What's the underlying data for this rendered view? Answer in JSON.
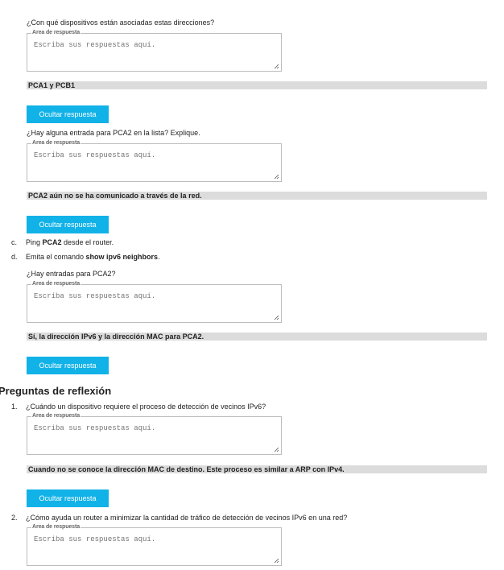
{
  "common": {
    "legend": "Area de respuesta",
    "placeholder": "Escriba sus respuestas aquí.",
    "hide_label": "Ocultar respuesta"
  },
  "q1": {
    "text": "¿Con qué dispositivos están asociadas estas direcciones?",
    "answer": "PCA1 y PCB1"
  },
  "q2": {
    "text": "¿Hay alguna entrada para PCA2 en la lista? Explique.",
    "answer": "PCA2 aún no se ha comunicado a través de la red."
  },
  "step_c": {
    "marker": "c.",
    "pre": "Ping ",
    "bold": "PCA2",
    "post": " desde el router."
  },
  "step_d": {
    "marker": "d.",
    "pre": "Emita el comando ",
    "bold": "show ipv6 neighbors",
    "post": "."
  },
  "q3": {
    "text": "¿Hay entradas para PCA2?",
    "answer": "Sí, la dirección IPv6 y la dirección MAC para PCA2."
  },
  "reflection": {
    "title": "Preguntas de reflexión",
    "items": [
      {
        "marker": "1.",
        "text": "¿Cuándo un dispositivo requiere el proceso de detección de vecinos IPv6?",
        "answer": "Cuando no se conoce la dirección MAC de destino. Este proceso es similar a ARP con IPv4."
      },
      {
        "marker": "2.",
        "text": "¿Cómo ayuda un router a minimizar la cantidad de tráfico de detección de vecinos IPv6 en una red?"
      }
    ]
  }
}
